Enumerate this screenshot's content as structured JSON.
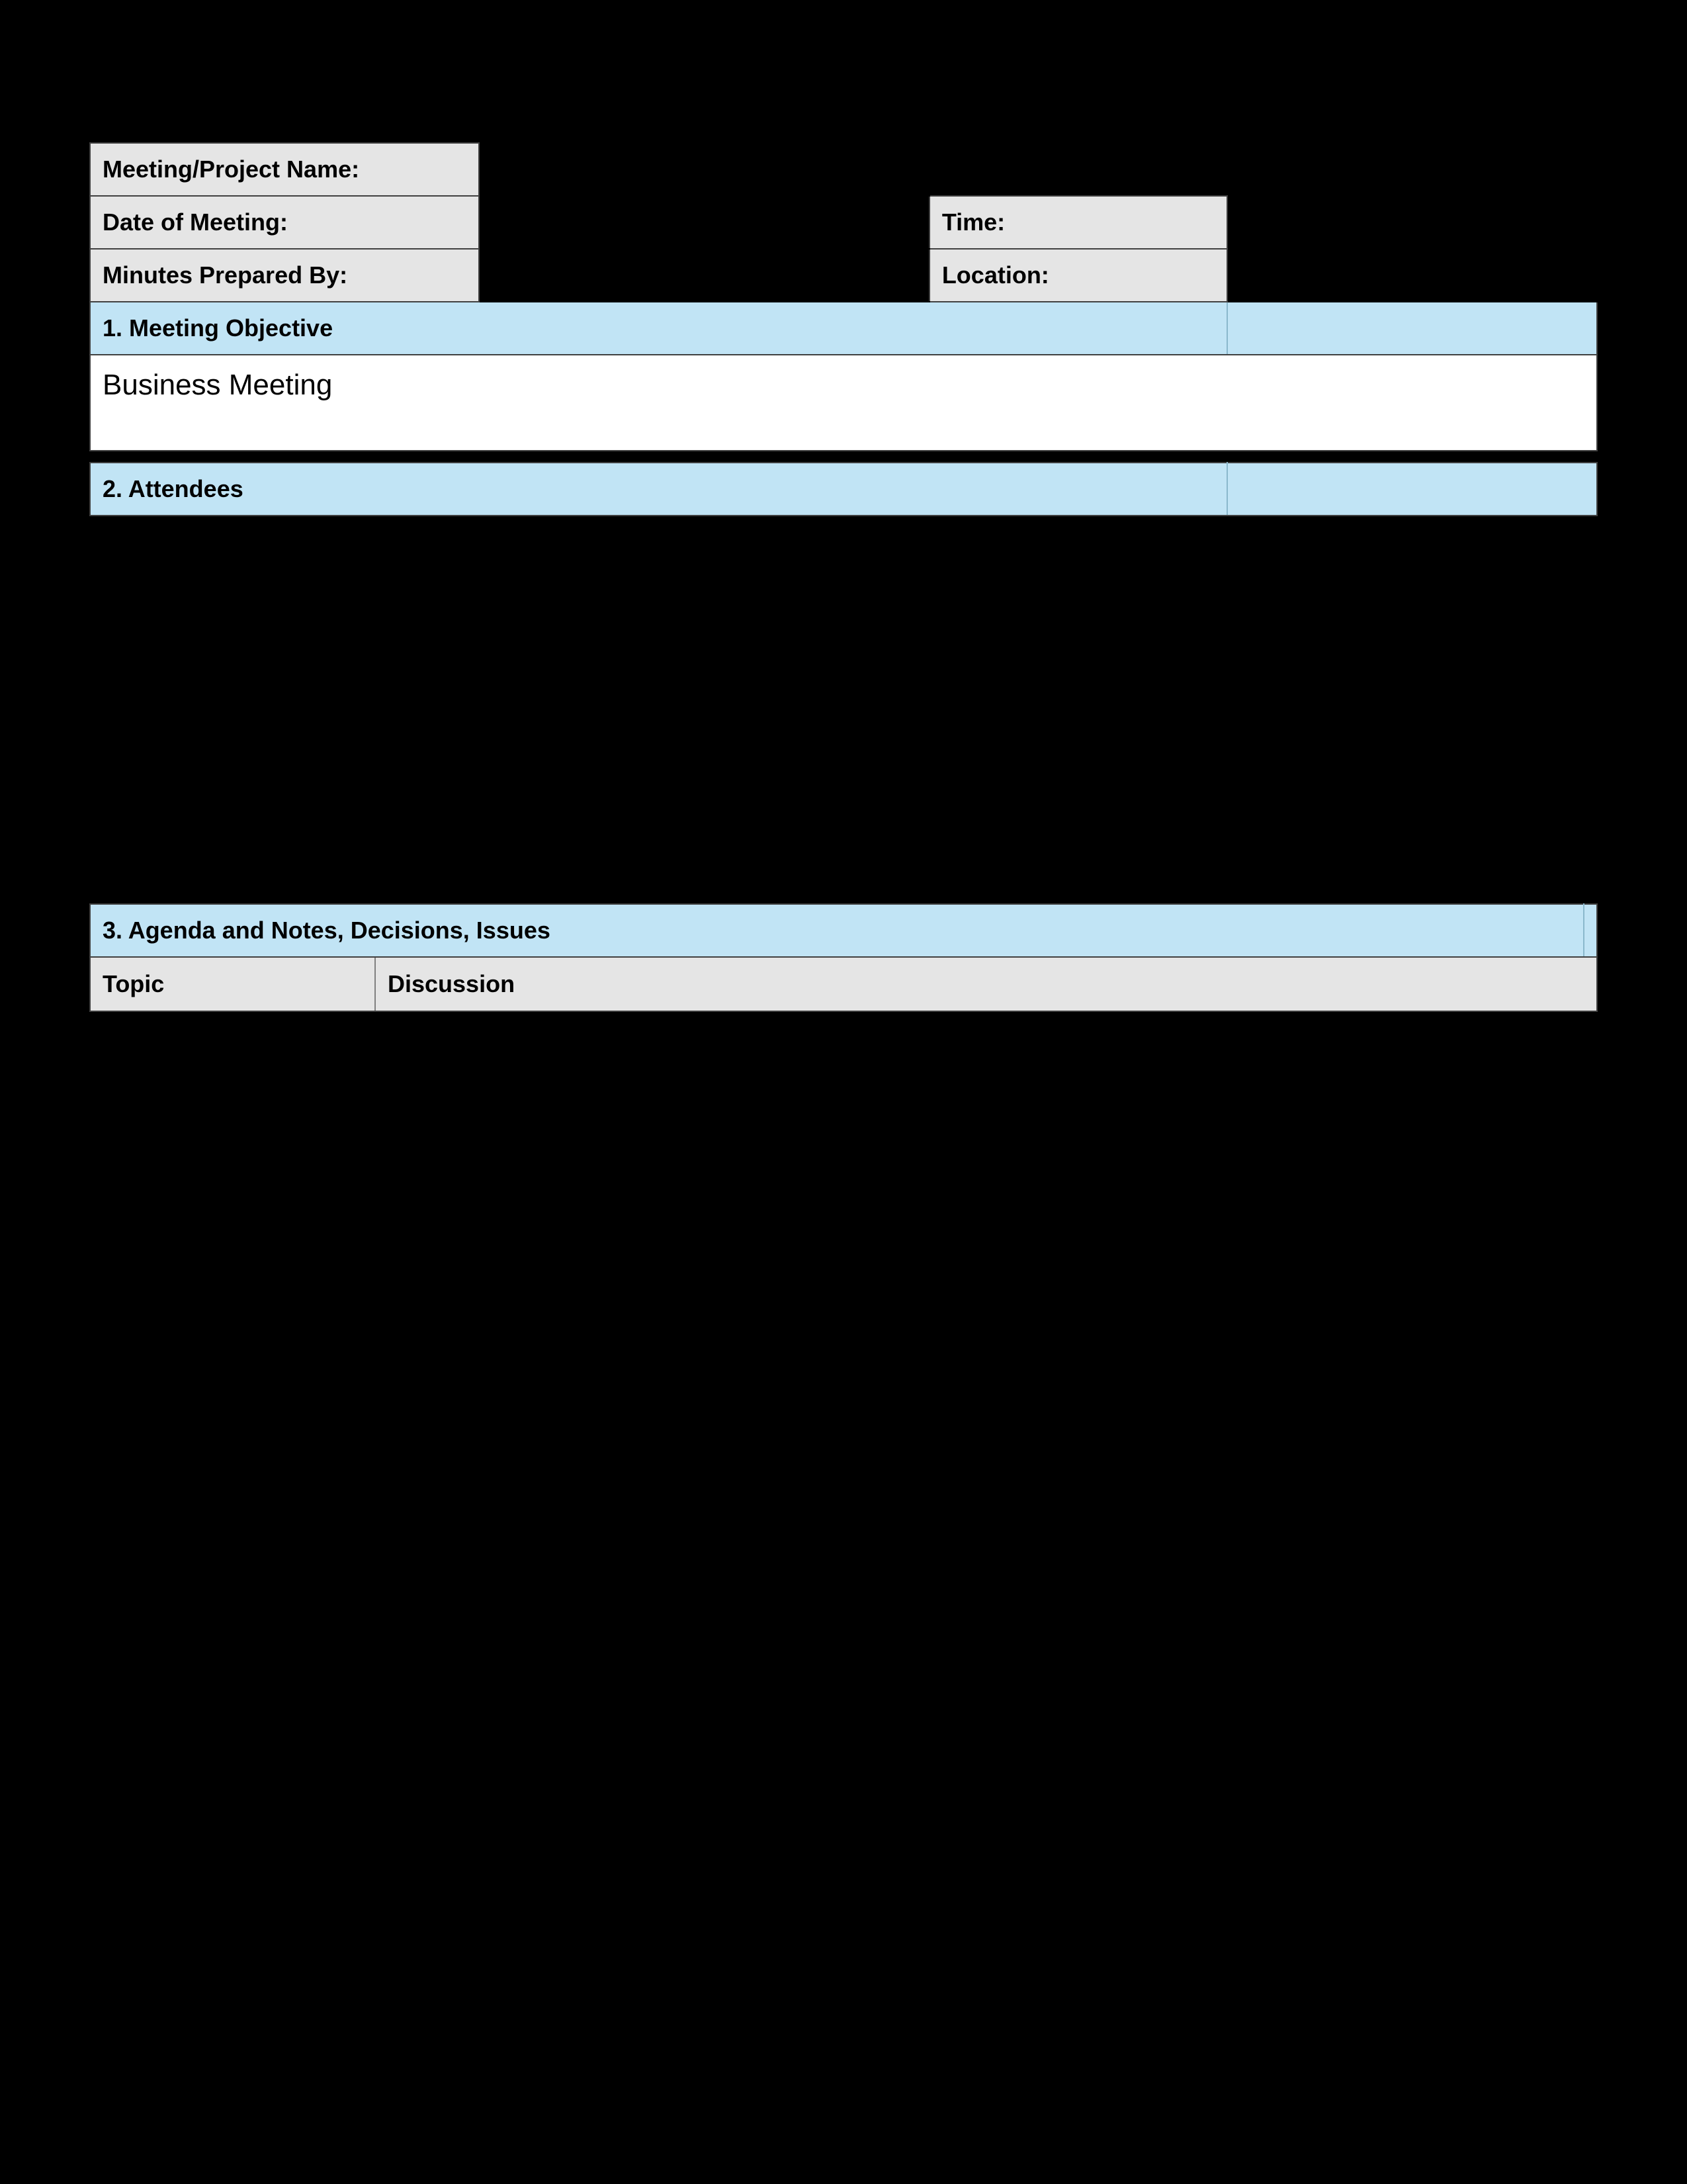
{
  "header": {
    "meeting_name_label": "Meeting/Project Name:",
    "date_label": "Date of Meeting:",
    "time_label": "Time:",
    "minutes_by_label": "Minutes Prepared By:",
    "location_label": "Location:"
  },
  "section1": {
    "title": "1. Meeting Objective",
    "value": "Business Meeting"
  },
  "section2": {
    "title": "2. Attendees"
  },
  "section3": {
    "title": "3. Agenda and Notes, Decisions, Issues",
    "col_topic": "Topic",
    "col_discussion": "Discussion"
  }
}
